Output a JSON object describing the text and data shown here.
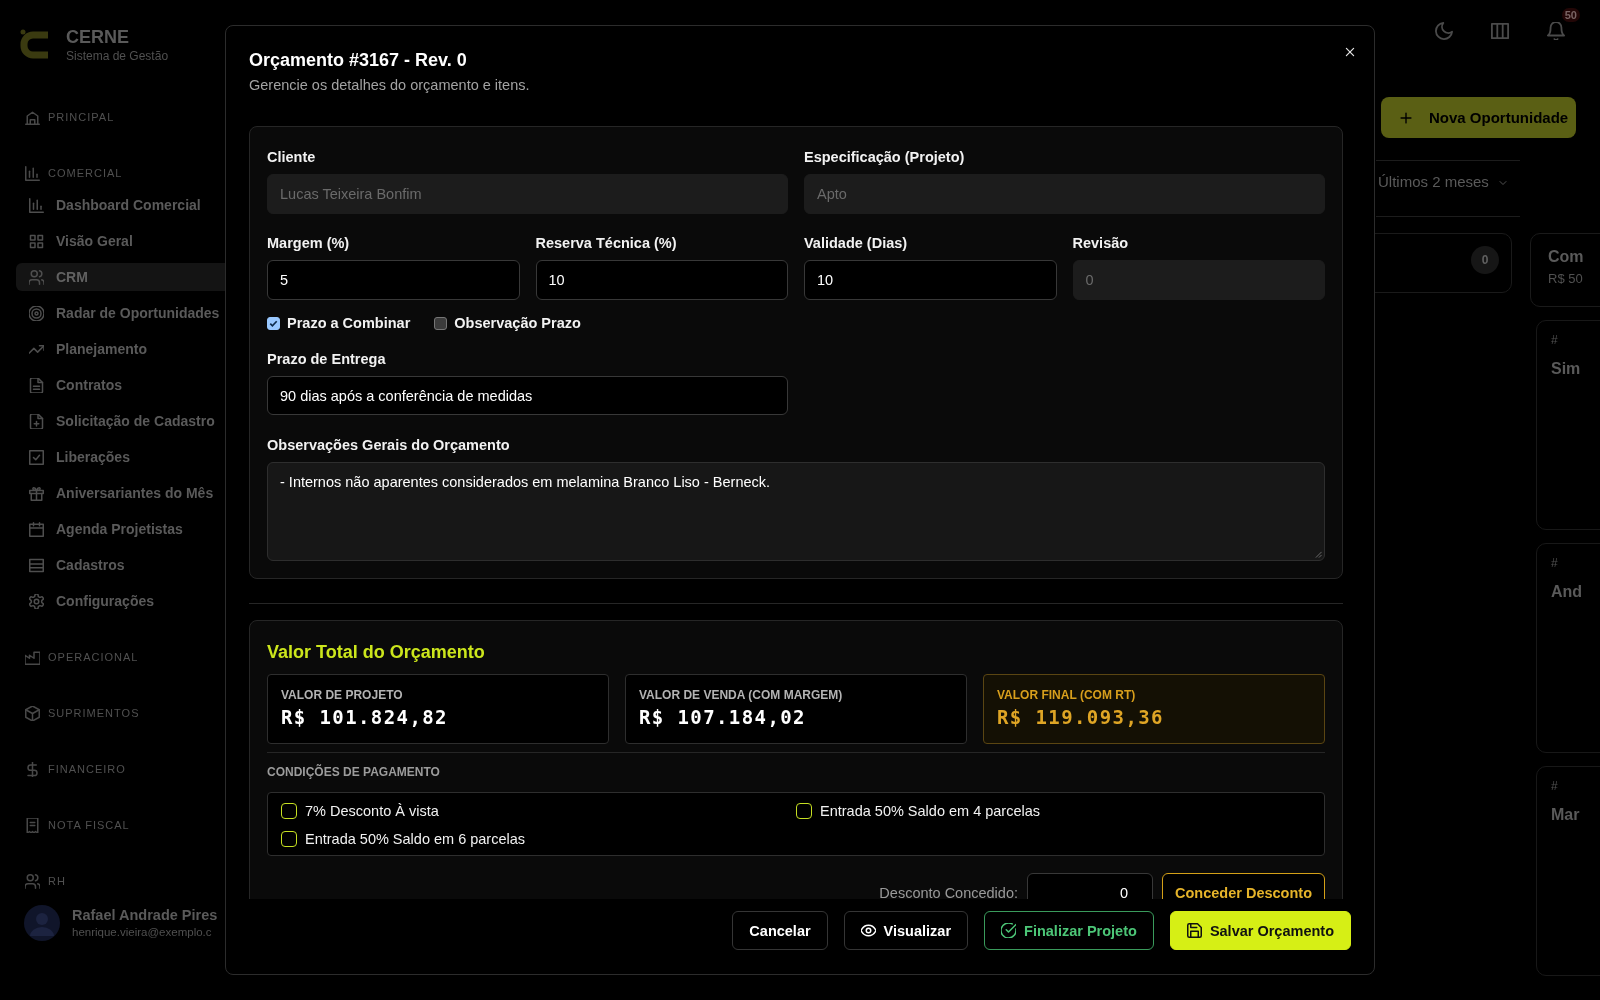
{
  "sidebar": {
    "brand": {
      "name": "CERNE",
      "tagline": "Sistema de Gestão"
    },
    "sections": [
      {
        "label": "PRINCIPAL"
      },
      {
        "label": "COMERCIAL",
        "items": [
          {
            "label": "Dashboard Comercial",
            "selected": false
          },
          {
            "label": "Visão Geral",
            "selected": false
          },
          {
            "label": "CRM",
            "selected": true
          },
          {
            "label": "Radar de Oportunidades",
            "selected": false
          },
          {
            "label": "Planejamento",
            "selected": false
          },
          {
            "label": "Contratos",
            "selected": false
          },
          {
            "label": "Solicitação de Cadastro",
            "selected": false
          },
          {
            "label": "Liberações",
            "selected": false
          },
          {
            "label": "Aniversariantes do Mês",
            "selected": false
          },
          {
            "label": "Agenda Projetistas",
            "selected": false
          },
          {
            "label": "Cadastros",
            "selected": false
          },
          {
            "label": "Configurações",
            "selected": false
          }
        ]
      },
      {
        "label": "OPERACIONAL"
      },
      {
        "label": "SUPRIMENTOS"
      },
      {
        "label": "FINANCEIRO"
      },
      {
        "label": "NOTA FISCAL"
      },
      {
        "label": "RH"
      }
    ],
    "user": {
      "name": "Rafael Andrade Pires",
      "email": "henrique.vieira@exemplo.c"
    }
  },
  "header": {
    "notification_count": "50"
  },
  "toolbar": {
    "new_button": "Nova Oportunidade",
    "period_filter": "Últimos 2 meses"
  },
  "board": {
    "columns": [
      {
        "count": "0"
      },
      {
        "title": "Com",
        "total": "R$ 50",
        "cards": [
          {
            "number": "#",
            "title": "Sim"
          },
          {
            "number": "#",
            "title": "And"
          },
          {
            "number": "#",
            "title": "Mar"
          }
        ]
      }
    ]
  },
  "modal": {
    "title": "Orçamento #3167 - Rev. 0",
    "subtitle": "Gerencie os detalhes do orçamento e itens.",
    "details": {
      "row_1": [
        {
          "label": "Cliente",
          "value": "Lucas Teixeira Bonfim",
          "disabled": true
        },
        {
          "label": "Especificação (Projeto)",
          "value": "Apto",
          "disabled": true
        }
      ],
      "row_2": [
        {
          "label": "Margem (%)",
          "value": "5",
          "disabled": false
        },
        {
          "label": "Reserva Técnica (%)",
          "value": "10",
          "disabled": false
        },
        {
          "label": "Validade (Dias)",
          "value": "10",
          "disabled": false
        },
        {
          "label": "Revisão",
          "value": "0",
          "disabled": true
        }
      ],
      "options": [
        {
          "label": "Prazo a Combinar",
          "checked": true
        },
        {
          "label": "Observação Prazo",
          "checked": false
        }
      ],
      "delivery": {
        "label": "Prazo de Entrega",
        "value": "90 dias após a conferência de medidas"
      },
      "notes": {
        "label": "Observações Gerais do Orçamento",
        "value": "- Internos não aparentes considerados em melamina Branco Liso - Berneck."
      }
    },
    "summary": {
      "title": "Valor Total do Orçamento",
      "totals": [
        {
          "label": "VALOR DE PROJETO",
          "value": "R$ 101.824,82",
          "highlighted": false
        },
        {
          "label": "VALOR DE VENDA (COM MARGEM)",
          "value": "R$ 107.184,02",
          "highlighted": false
        },
        {
          "label": "VALOR FINAL (COM RT)",
          "value": "R$ 119.093,36",
          "highlighted": true
        }
      ],
      "payment_title": "CONDIÇÕES DE PAGAMENTO",
      "payment_options": [
        {
          "label": "7% Desconto À vista",
          "checked": false
        },
        {
          "label": "Entrada 50% Saldo em 4 parcelas",
          "checked": false
        },
        {
          "label": "Entrada 50% Saldo em 6 parcelas",
          "checked": false
        }
      ],
      "discount": {
        "label": "Desconto Concedido:",
        "value": "0",
        "button": "Conceder Desconto"
      }
    },
    "buttons": [
      {
        "label": "Cancelar",
        "kind": "cancel"
      },
      {
        "label": "Visualizar",
        "kind": "preview"
      },
      {
        "label": "Finalizar Projeto",
        "kind": "finish"
      },
      {
        "label": "Salvar Orçamento",
        "kind": "save"
      }
    ]
  }
}
